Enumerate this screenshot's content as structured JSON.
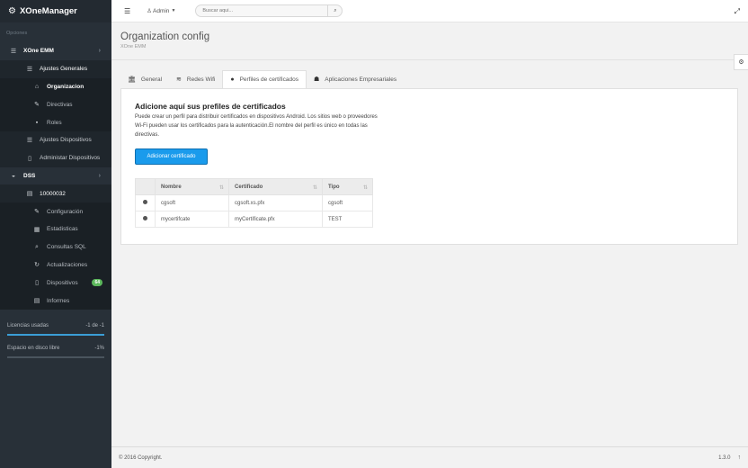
{
  "brand": {
    "title": "XOneManager"
  },
  "sidebar": {
    "section_label": "Opciones",
    "items": [
      {
        "label": "XOne EMM",
        "icon": "list-icon"
      },
      {
        "label": "Ajustes Generales",
        "icon": "list-icon"
      },
      {
        "label": "Organizacion",
        "icon": "home-icon"
      },
      {
        "label": "Directivas",
        "icon": "wrench-icon"
      },
      {
        "label": "Roles",
        "icon": "lock-icon"
      },
      {
        "label": "Ajustes Dispositivos",
        "icon": "list-icon"
      },
      {
        "label": "Administar Dispositivos",
        "icon": "mobile-icon"
      },
      {
        "label": "DSS",
        "icon": "dashboard-icon"
      },
      {
        "label": "10000032",
        "icon": "file-icon"
      },
      {
        "label": "Configuración",
        "icon": "wrench-icon"
      },
      {
        "label": "Estadisticas",
        "icon": "chart-icon"
      },
      {
        "label": "Consultas SQL",
        "icon": "search-icon"
      },
      {
        "label": "Actualizaciones",
        "icon": "refresh-icon"
      },
      {
        "label": "Dispositivos",
        "icon": "mobile-icon",
        "badge": "64"
      },
      {
        "label": "Informes",
        "icon": "file-icon"
      }
    ],
    "stats": {
      "licencias_label": "Licencias usadas",
      "licencias_value": "-1 de -1",
      "disco_label": "Espacio en disco libre",
      "disco_value": "-1%"
    }
  },
  "topbar": {
    "user_label": "Admin",
    "search_placeholder": "Buscar aqui..."
  },
  "page": {
    "title": "Organization config",
    "subtitle": "XOne EMM"
  },
  "tabs": [
    {
      "label": "General",
      "icon": "bank-icon"
    },
    {
      "label": "Redes Wifi",
      "icon": "wifi-icon"
    },
    {
      "label": "Perfiles de certificados",
      "icon": "circle-icon"
    },
    {
      "label": "Aplicaciones Empresariales",
      "icon": "users-icon"
    }
  ],
  "panel": {
    "heading": "Adicione aquí sus prefiles de certificados",
    "description": "Puede crear un perfil para distribuir certificados en dispositivos Android. Los sitios web o proveedores Wi-Fi pueden usar los certificados para la autenticación.El nombre del perfil es único en todas las directivas.",
    "add_button": "Adicionar certificado"
  },
  "table": {
    "headers": [
      "Nombre",
      "Certificado",
      "Tipo"
    ],
    "rows": [
      {
        "nombre": "cgsoft",
        "certificado": "cgsoft.xs.pfx",
        "tipo": "cgsoft"
      },
      {
        "nombre": "mycertifcate",
        "certificado": "myCertificate.pfx",
        "tipo": "TEST"
      }
    ]
  },
  "footer": {
    "copyright": "© 2016 Copyright.",
    "version": "1.3.0"
  }
}
